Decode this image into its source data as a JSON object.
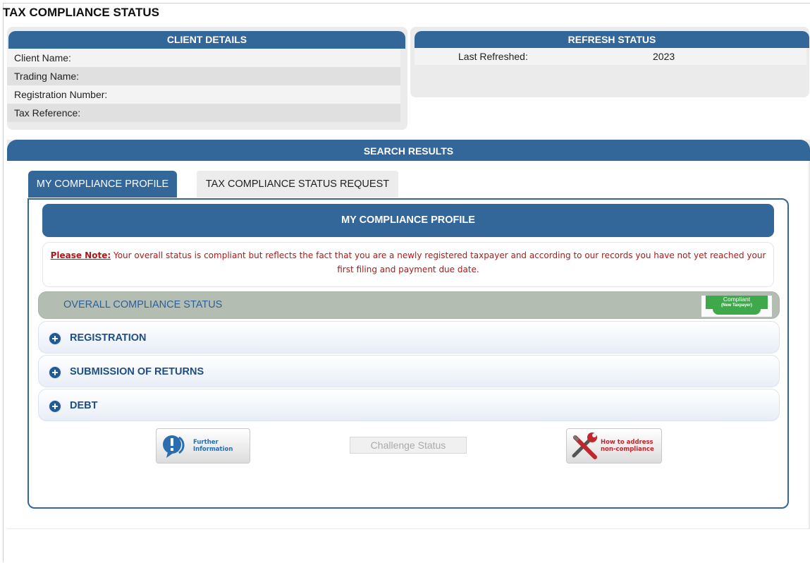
{
  "page": {
    "title": "TAX COMPLIANCE STATUS"
  },
  "client_details": {
    "header": "CLIENT DETAILS",
    "rows": [
      {
        "label": "Client Name:"
      },
      {
        "label": "Trading Name:"
      },
      {
        "label": "Registration Number:"
      },
      {
        "label": "Tax Reference:"
      }
    ]
  },
  "refresh_status": {
    "header": "REFRESH STATUS",
    "label": "Last Refreshed:",
    "value": "2023"
  },
  "search_results": {
    "header": "SEARCH RESULTS",
    "tabs": [
      {
        "label": "MY COMPLIANCE PROFILE",
        "active": true
      },
      {
        "label": "TAX COMPLIANCE STATUS REQUEST",
        "active": false
      }
    ],
    "profile": {
      "header": "MY COMPLIANCE PROFILE",
      "note_label": "Please Note:",
      "note_text": " Your overall status is compliant but reflects the fact that you are a newly registered taxpayer and according to our records you have not yet reached your first filing and payment due date.",
      "overall_label": "OVERALL COMPLIANCE STATUS",
      "badge_main": "Compliant",
      "badge_sub": "(New Taxpayer)",
      "sections": [
        {
          "label": "REGISTRATION"
        },
        {
          "label": "SUBMISSION OF RETURNS"
        },
        {
          "label": "DEBT"
        }
      ],
      "buttons": {
        "further_info_line1": "Further",
        "further_info_line2": "Information",
        "challenge": "Challenge Status",
        "address_line1": "How to address",
        "address_line2": "non-compliance"
      }
    }
  },
  "colors": {
    "header_blue": "#336699",
    "status_green": "#3ea84a",
    "note_red": "#b01818"
  }
}
